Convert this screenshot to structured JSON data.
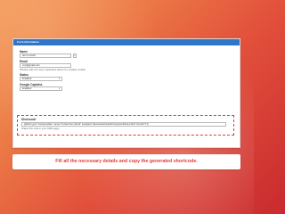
{
  "panel": {
    "header_title": "Form Information"
  },
  "fields": {
    "name": {
      "label": "Name",
      "value": "Get in touch"
    },
    "email": {
      "label": "Email",
      "value": "xxx@gmail.com",
      "note": "(Please add comma(,) separated values for multiple emails)"
    },
    "status": {
      "label": "Status",
      "value": "Enabled"
    },
    "captcha": {
      "label": "Google Captcha",
      "value": "Enabled"
    }
  },
  "shortcode": {
    "label": "Shortcode",
    "value": "{{block type=\"core/template\" name=\"contact.form.block\" template=\"advancedcontactform/system/block.phtml\" formid=\"1\"}}",
    "note": "(Paste this code in your CMS page)"
  },
  "instruction": {
    "text": "Fill all the necessary details and copy the generated shortcode."
  }
}
